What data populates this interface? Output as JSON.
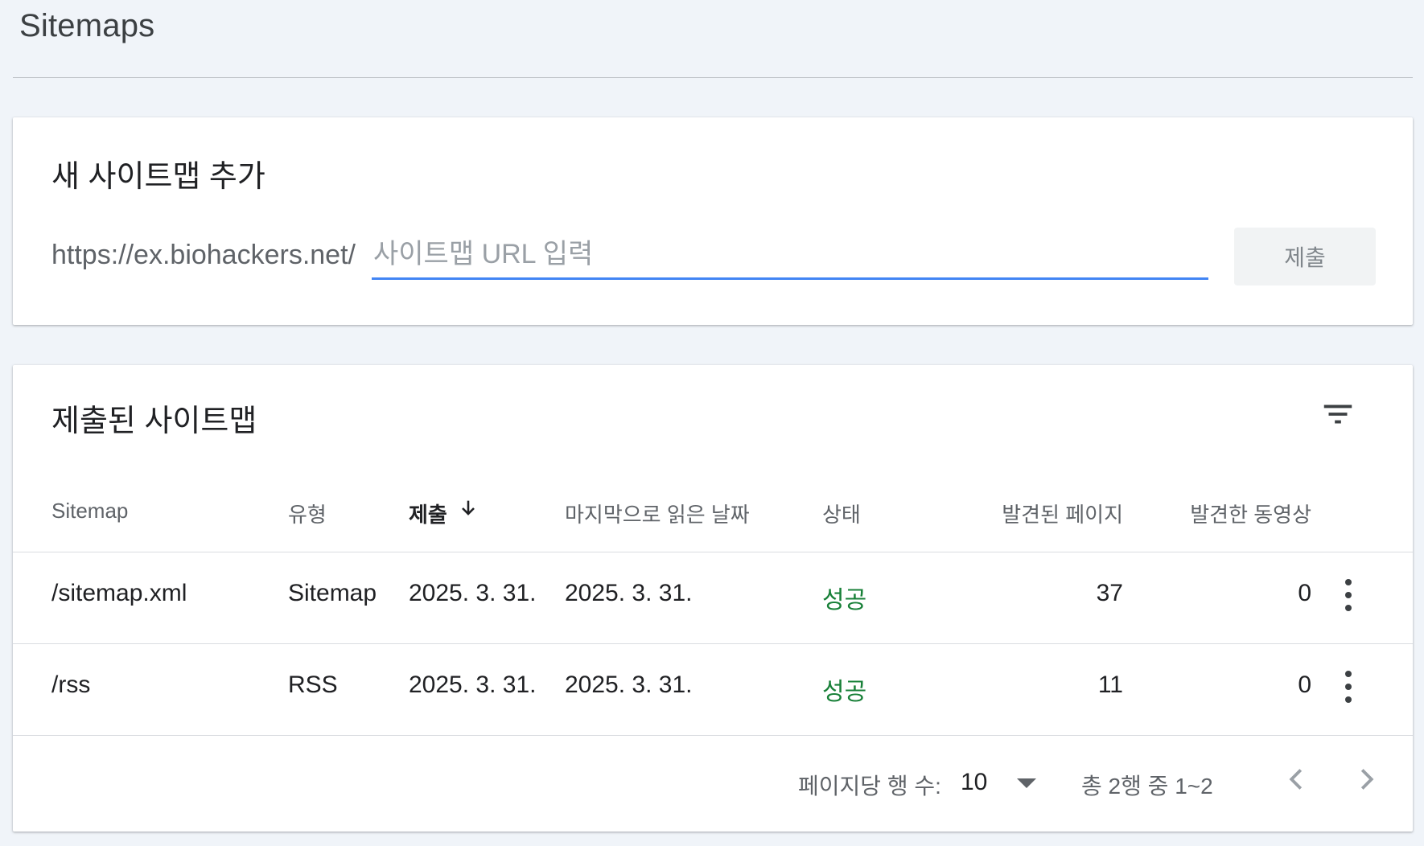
{
  "page": {
    "title": "Sitemaps"
  },
  "add_card": {
    "title": "새 사이트맵 추가",
    "url_prefix": "https://ex.biohackers.net/",
    "input_placeholder": "사이트맵 URL 입력",
    "input_value": "",
    "submit_label": "제출"
  },
  "list_card": {
    "title": "제출된 사이트맵",
    "headers": {
      "sitemap": "Sitemap",
      "type": "유형",
      "submitted": "제출",
      "last_read": "마지막으로 읽은 날짜",
      "status": "상태",
      "pages": "발견된 페이지",
      "videos": "발견한 동영상"
    },
    "rows": [
      {
        "sitemap": "/sitemap.xml",
        "type": "Sitemap",
        "submitted": "2025. 3. 31.",
        "last_read": "2025. 3. 31.",
        "status": "성공",
        "pages": "37",
        "videos": "0"
      },
      {
        "sitemap": "/rss",
        "type": "RSS",
        "submitted": "2025. 3. 31.",
        "last_read": "2025. 3. 31.",
        "status": "성공",
        "pages": "11",
        "videos": "0"
      }
    ],
    "footer": {
      "rows_per_page_label": "페이지당 행 수:",
      "rows_per_page_value": "10",
      "range_label": "총 2행 중 1~2"
    }
  },
  "colors": {
    "accent": "#4285f4",
    "success": "#188038",
    "background": "#f0f4f9"
  },
  "icons": [
    "filter-icon",
    "arrow-down-icon",
    "more-vert-icon",
    "dropdown-caret-icon",
    "chevron-left-icon",
    "chevron-right-icon"
  ]
}
